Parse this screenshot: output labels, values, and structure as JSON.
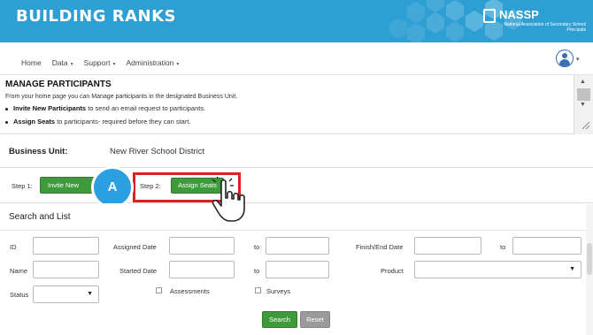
{
  "header": {
    "app_title": "BUILDING RANKS",
    "logo_name": "NASSP",
    "logo_subtitle": "National Association of Secondary School Principals"
  },
  "nav": {
    "items": [
      {
        "label": "Home",
        "has_menu": false
      },
      {
        "label": "Data",
        "has_menu": true
      },
      {
        "label": "Support",
        "has_menu": true
      },
      {
        "label": "Administration",
        "has_menu": true
      }
    ],
    "menu_caret": "▾",
    "avatar_icon": "user-icon"
  },
  "manage": {
    "title": "MANAGE PARTICIPANTS",
    "intro": "From your home page you can Manage participants in the designated Business Unit.",
    "bullets": [
      {
        "bold": "Invite New Participants",
        "rest": " to send an email request to participants."
      },
      {
        "bold": "Assign Seats",
        "rest": " to participants- required before they can start."
      }
    ]
  },
  "business_unit": {
    "label": "Business Unit:",
    "value": "New River School District"
  },
  "steps": {
    "step1_label": "Step 1:",
    "step1_button": "Invite New Participants",
    "step2_label": "Step 2:",
    "step2_button": "Assign Seats",
    "callout_badge": "A"
  },
  "search": {
    "title": "Search and List",
    "fields": {
      "id": "ID",
      "assigned_date": "Assigned Date",
      "to": "to",
      "finish_end_date": "Finish/End Date",
      "name": "Name",
      "started_date": "Started Date",
      "product": "Product",
      "status": "Status",
      "assessments": "Assessments",
      "surveys": "Surveys"
    },
    "values": {
      "id": "",
      "assigned_from": "",
      "assigned_to": "",
      "finish_from": "",
      "finish_to": "",
      "name": "",
      "started_from": "",
      "started_to": "",
      "product": "",
      "status": ""
    },
    "search_button": "Search",
    "reset_button": "Reset"
  },
  "colors": {
    "banner": "#2d9fd3",
    "primary_button": "#3f9a3c",
    "highlight": "#e01e1e",
    "badge": "#2b9fe0"
  }
}
